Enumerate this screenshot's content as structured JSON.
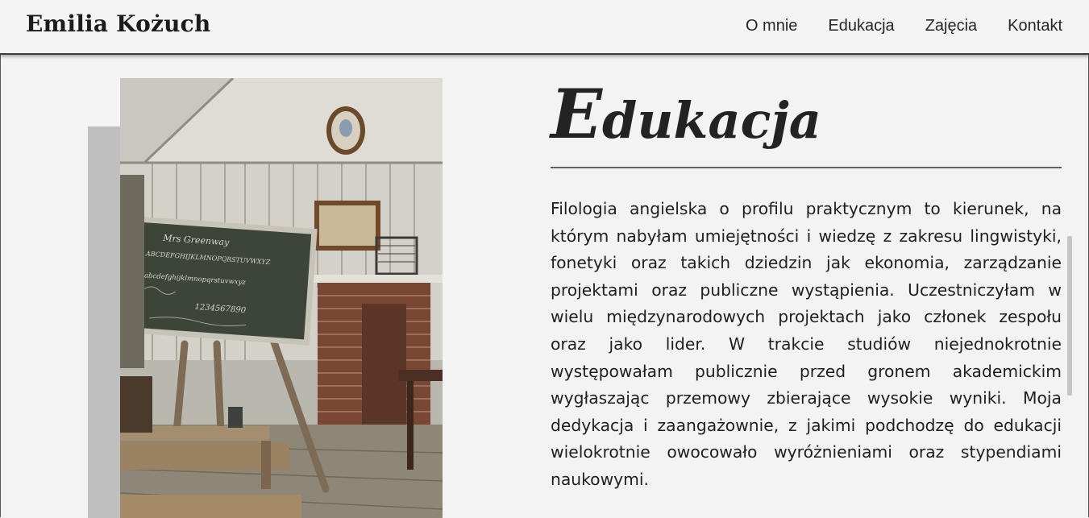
{
  "header": {
    "brand": "Emilia Kożuch",
    "nav": [
      "O mnie",
      "Edukacja",
      "Zajęcia",
      "Kontakt"
    ]
  },
  "main": {
    "title_first": "E",
    "title_rest": "dukacja",
    "paragraph": "Filologia angielska o profilu praktycznym to kierunek, na którym nabyłam umiejętności i wiedzę z zakresu lingwistyki, fonetyki oraz takich dziedzin jak ekonomia, zarządzanie projektami oraz publiczne wystąpienia. Uczestniczyłam w wielu międzynarodowych projektach jako członek zespołu oraz jako lider. W trakcie studiów niejednokrotnie występowałam publicznie przed gronem akademickim wygłaszając przemowy zbierające wysokie wyniki. Moja dedykacja i zaangażownie, z jakimi podchodzę do edukacji wielokrotnie owocowało wyróżnieniami oraz stypendiami naukowymi."
  },
  "photo": {
    "board_lines": [
      "Mrs Greenway",
      "ABCDEFGHIJKLMNOPQRSTUVWXYZ",
      "abcdefghijklmnopqrstuvwxyz",
      "1234567890"
    ]
  }
}
